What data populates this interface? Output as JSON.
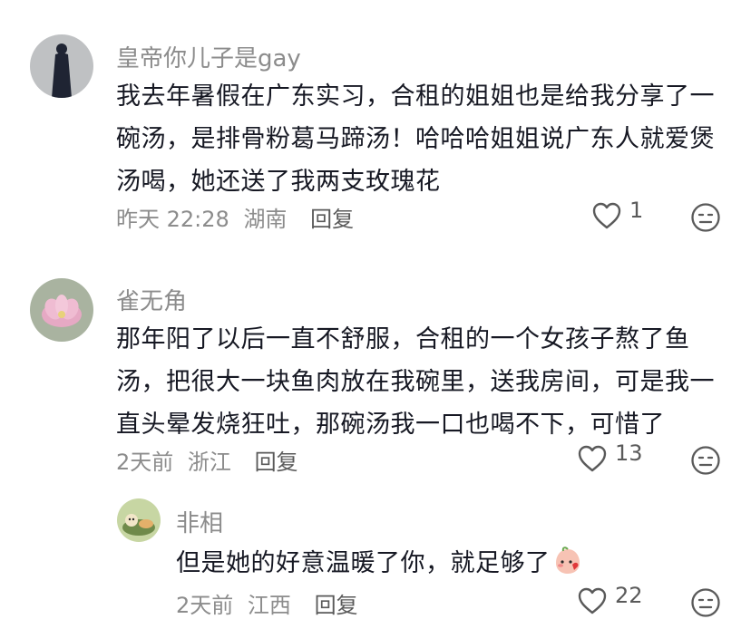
{
  "comments": [
    {
      "name": "皇帝你儿子是gay",
      "text": "我去年暑假在广东实习，合租的姐姐也是给我分享了一碗汤，是排骨粉葛马蹄汤！哈哈哈姐姐说广东人就爱煲汤喝，她还送了我两支玫瑰花",
      "time": "昨天 22:28",
      "location": "湖南",
      "reply_label": "回复",
      "likes": "1"
    },
    {
      "name": "雀无角",
      "text": "那年阳了以后一直不舒服，合租的一个女孩子熬了鱼汤，把很大一块鱼肉放在我碗里，送我房间，可是我一直头晕发烧狂吐，那碗汤我一口也喝不下，可惜了",
      "time": "2天前",
      "location": "浙江",
      "reply_label": "回复",
      "likes": "13"
    }
  ],
  "reply": {
    "name": "非相",
    "text": "但是她的好意温暖了你，就足够了",
    "time": "2天前",
    "location": "江西",
    "reply_label": "回复",
    "likes": "22"
  },
  "icons": {
    "like": "heart-outline-icon",
    "dislike": "meh-face-icon",
    "emoji": "blushing-peach-emoji"
  },
  "colors": {
    "text": "#161823",
    "muted": "#8c8c8c"
  }
}
